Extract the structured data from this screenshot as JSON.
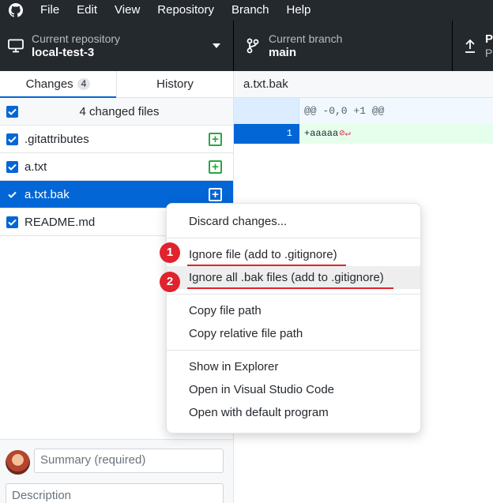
{
  "menubar": {
    "items": [
      "File",
      "Edit",
      "View",
      "Repository",
      "Branch",
      "Help"
    ]
  },
  "toolbar": {
    "repo_label": "Current repository",
    "repo_value": "local-test-3",
    "branch_label": "Current branch",
    "branch_value": "main",
    "push_label": "P",
    "push_sub": "P"
  },
  "tabs": {
    "changes_label": "Changes",
    "changes_count": "4",
    "history_label": "History"
  },
  "files": {
    "header": "4 changed files",
    "items": [
      {
        "name": ".gitattributes",
        "status": "added"
      },
      {
        "name": "a.txt",
        "status": "added"
      },
      {
        "name": "a.txt.bak",
        "status": "added"
      },
      {
        "name": "README.md",
        "status": "added"
      }
    ]
  },
  "commit": {
    "summary_placeholder": "Summary (required)",
    "description_placeholder": "Description"
  },
  "diff": {
    "filename": "a.txt.bak",
    "hunk": "@@ -0,0 +1 @@",
    "line_no": "1",
    "line_text": "+aaaaa"
  },
  "context_menu": {
    "items": [
      "Discard changes...",
      "Ignore file (add to .gitignore)",
      "Ignore all .bak files (add to .gitignore)",
      "Copy file path",
      "Copy relative file path",
      "Show in Explorer",
      "Open in Visual Studio Code",
      "Open with default program"
    ],
    "markers": [
      "1",
      "2"
    ]
  },
  "colors": {
    "accent": "#0366d6",
    "chrome": "#24292e",
    "added": "#28a745",
    "annotation": "#e0232c"
  }
}
